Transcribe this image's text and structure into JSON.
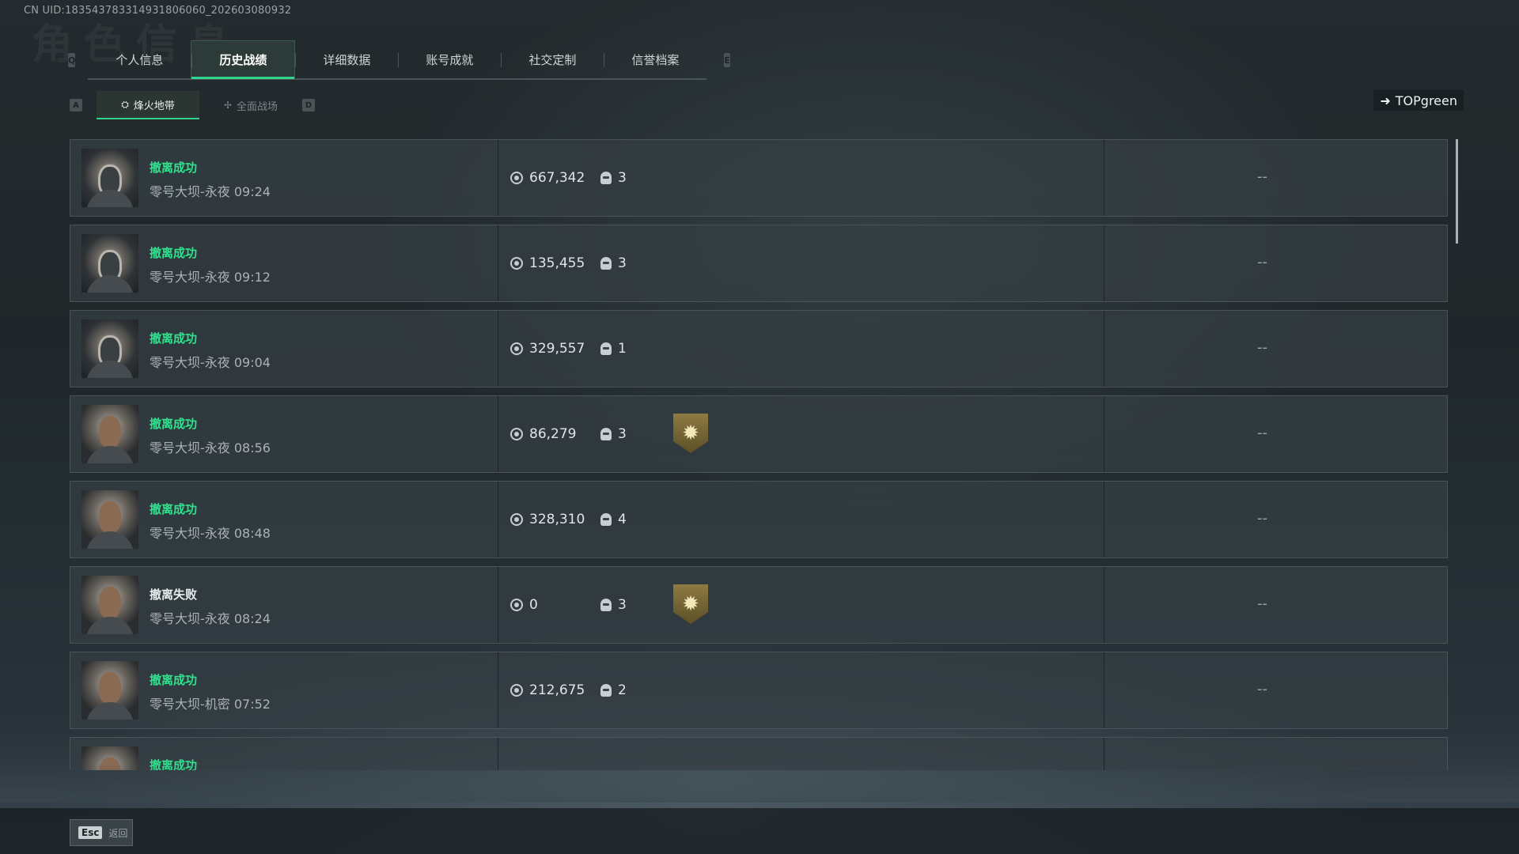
{
  "header": {
    "uid_text": "CN UID:18354378331493180606​0_202603080932",
    "bg_title": "角色信息"
  },
  "tabs": {
    "left_key": "Q",
    "right_key": "E",
    "items": [
      {
        "label": "个人信息",
        "active": false
      },
      {
        "label": "历史战绩",
        "active": true
      },
      {
        "label": "详细数据",
        "active": false
      },
      {
        "label": "账号成就",
        "active": false
      },
      {
        "label": "社交定制",
        "active": false
      },
      {
        "label": "信誉档案",
        "active": false
      }
    ]
  },
  "subtabs": {
    "left_key": "A",
    "right_key": "D",
    "items": [
      {
        "label": "烽火地带",
        "active": true
      },
      {
        "label": "全面战场",
        "active": false
      }
    ]
  },
  "player": {
    "name": "TOPgreen"
  },
  "matches": [
    {
      "status": "撤离成功",
      "success": true,
      "map": "零号大坝-永夜 09:24",
      "value": "667,342",
      "kills": "3",
      "badge": false,
      "extra": "--",
      "avatar": "helmet"
    },
    {
      "status": "撤离成功",
      "success": true,
      "map": "零号大坝-永夜 09:12",
      "value": "135,455",
      "kills": "3",
      "badge": false,
      "extra": "--",
      "avatar": "helmet"
    },
    {
      "status": "撤离成功",
      "success": true,
      "map": "零号大坝-永夜 09:04",
      "value": "329,557",
      "kills": "1",
      "badge": false,
      "extra": "--",
      "avatar": "helmet"
    },
    {
      "status": "撤离成功",
      "success": true,
      "map": "零号大坝-永夜 08:56",
      "value": "86,279",
      "kills": "3",
      "badge": true,
      "extra": "--",
      "avatar": "face"
    },
    {
      "status": "撤离成功",
      "success": true,
      "map": "零号大坝-永夜 08:48",
      "value": "328,310",
      "kills": "4",
      "badge": false,
      "extra": "--",
      "avatar": "face"
    },
    {
      "status": "撤离失败",
      "success": false,
      "map": "零号大坝-永夜 08:24",
      "value": "0",
      "kills": "3",
      "badge": true,
      "extra": "--",
      "avatar": "face"
    },
    {
      "status": "撤离成功",
      "success": true,
      "map": "零号大坝-机密 07:52",
      "value": "212,675",
      "kills": "2",
      "badge": false,
      "extra": "--",
      "avatar": "face"
    },
    {
      "status": "撤离成功",
      "success": true,
      "map": "",
      "value": "",
      "kills": "",
      "badge": false,
      "extra": "",
      "avatar": "face"
    }
  ],
  "footer": {
    "esc_key": "Esc",
    "back_label": "返回"
  },
  "colors": {
    "accent": "#2fd58c",
    "success": "#2fe38e",
    "fail": "#e8eeee"
  },
  "icons": {
    "value": "coin-icon",
    "kills": "skull-icon",
    "badge": "rank-badge-icon",
    "player": "arrow-icon"
  }
}
